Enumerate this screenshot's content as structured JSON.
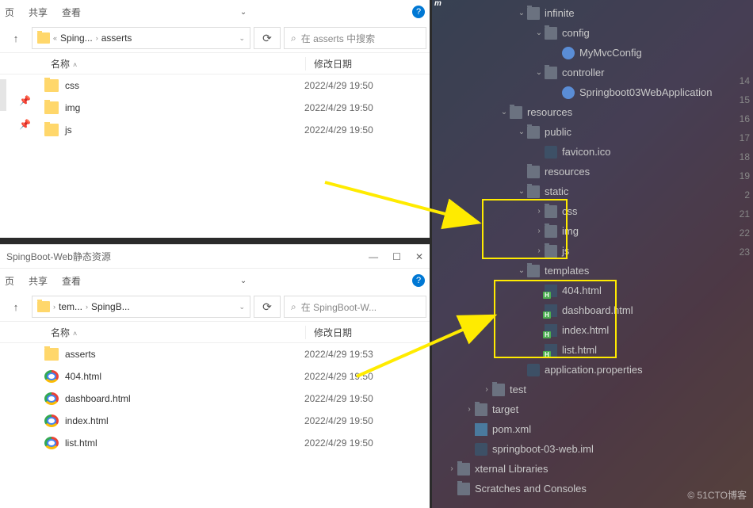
{
  "win1": {
    "tabs": {
      "prev": "页",
      "share": "共享",
      "view": "查看"
    },
    "breadcrumb": {
      "p1": "Sping...",
      "p2": "asserts"
    },
    "search_placeholder": "在 asserts 中搜索",
    "cols": {
      "name": "名称",
      "date": "修改日期"
    },
    "files": [
      {
        "name": "css",
        "date": "2022/4/29 19:50",
        "type": "folder"
      },
      {
        "name": "img",
        "date": "2022/4/29 19:50",
        "type": "folder"
      },
      {
        "name": "js",
        "date": "2022/4/29 19:50",
        "type": "folder"
      }
    ]
  },
  "win2": {
    "title": "SpingBoot-Web静态资源",
    "tabs": {
      "prev": "页",
      "share": "共享",
      "view": "查看"
    },
    "breadcrumb": {
      "p1": "tem...",
      "p2": "SpingB..."
    },
    "search_placeholder": "在 SpingBoot-W...",
    "cols": {
      "name": "名称",
      "date": "修改日期"
    },
    "files": [
      {
        "name": "asserts",
        "date": "2022/4/29 19:53",
        "type": "folder"
      },
      {
        "name": "404.html",
        "date": "2022/4/29 19:50",
        "type": "chrome"
      },
      {
        "name": "dashboard.html",
        "date": "2022/4/29 19:50",
        "type": "chrome"
      },
      {
        "name": "index.html",
        "date": "2022/4/29 19:50",
        "type": "chrome"
      },
      {
        "name": "list.html",
        "date": "2022/4/29 19:50",
        "type": "chrome"
      }
    ]
  },
  "ide": {
    "tree": [
      {
        "depth": 3,
        "exp": "v",
        "icon": "folder",
        "label": "infinite"
      },
      {
        "depth": 4,
        "exp": "v",
        "icon": "folder",
        "label": "config"
      },
      {
        "depth": 5,
        "exp": "",
        "icon": "class",
        "label": "MyMvcConfig"
      },
      {
        "depth": 4,
        "exp": "v",
        "icon": "folder",
        "label": "controller"
      },
      {
        "depth": 5,
        "exp": "",
        "icon": "class",
        "label": "Springboot03WebApplication"
      },
      {
        "depth": 2,
        "exp": "v",
        "icon": "folder",
        "label": "resources"
      },
      {
        "depth": 3,
        "exp": "v",
        "icon": "folder",
        "label": "public"
      },
      {
        "depth": 4,
        "exp": "",
        "icon": "file",
        "label": "favicon.ico"
      },
      {
        "depth": 3,
        "exp": "",
        "icon": "folder",
        "label": "resources"
      },
      {
        "depth": 3,
        "exp": "v",
        "icon": "folder",
        "label": "static"
      },
      {
        "depth": 4,
        "exp": ">",
        "icon": "folder",
        "label": "css"
      },
      {
        "depth": 4,
        "exp": ">",
        "icon": "folder",
        "label": "img"
      },
      {
        "depth": 4,
        "exp": ">",
        "icon": "folder",
        "label": "js"
      },
      {
        "depth": 3,
        "exp": "v",
        "icon": "folder",
        "label": "templates"
      },
      {
        "depth": 4,
        "exp": "",
        "icon": "html",
        "label": "404.html"
      },
      {
        "depth": 4,
        "exp": "",
        "icon": "html",
        "label": "dashboard.html"
      },
      {
        "depth": 4,
        "exp": "",
        "icon": "html",
        "label": "index.html"
      },
      {
        "depth": 4,
        "exp": "",
        "icon": "html",
        "label": "list.html"
      },
      {
        "depth": 3,
        "exp": "",
        "icon": "file",
        "label": "application.properties"
      },
      {
        "depth": 1,
        "exp": ">",
        "icon": "folder",
        "label": "test"
      },
      {
        "depth": 0,
        "exp": ">",
        "icon": "folder",
        "label": "target"
      },
      {
        "depth": 0,
        "exp": "",
        "icon": "xml",
        "label": "pom.xml"
      },
      {
        "depth": 0,
        "exp": "",
        "icon": "file",
        "label": "springboot-03-web.iml"
      },
      {
        "depth": -1,
        "exp": ">",
        "icon": "folder",
        "label": "xternal Libraries"
      },
      {
        "depth": -1,
        "exp": "",
        "icon": "folder",
        "label": "Scratches and Consoles"
      }
    ],
    "line_numbers": [
      "14",
      "15",
      "16",
      "17",
      "18",
      "19",
      "2",
      "21",
      "22",
      "23"
    ],
    "watermark": "© 51CTO博客"
  }
}
